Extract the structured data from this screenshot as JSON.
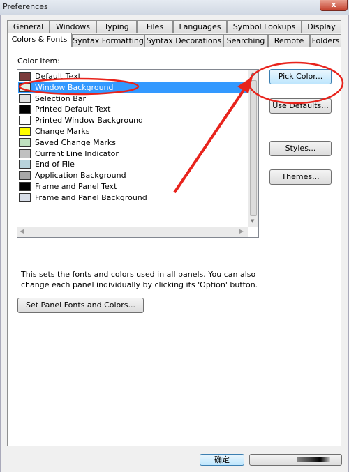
{
  "window": {
    "title": "Preferences",
    "close_label": "x"
  },
  "tabs_row1": [
    "General",
    "Windows",
    "Typing",
    "Files",
    "Languages",
    "Symbol Lookups",
    "Display"
  ],
  "tabs_row2": [
    "Colors & Fonts",
    "Syntax Formatting",
    "Syntax Decorations",
    "Searching",
    "Remote",
    "Folders"
  ],
  "active_tab": "Colors & Fonts",
  "color_item_label": "Color Item:",
  "color_items": [
    {
      "label": "Default Text",
      "color": "#7b3a3a"
    },
    {
      "label": "Window Background",
      "color": "#dfeee0",
      "selected": true
    },
    {
      "label": "Selection Bar",
      "color": "#e0e0e0"
    },
    {
      "label": "Printed Default Text",
      "color": "#000000"
    },
    {
      "label": "Printed Window Background",
      "color": "#ffffff"
    },
    {
      "label": "Change Marks",
      "color": "#ffff00"
    },
    {
      "label": "Saved Change Marks",
      "color": "#bfe0bf"
    },
    {
      "label": "Current Line Indicator",
      "color": "#c0c0c0"
    },
    {
      "label": "End of File",
      "color": "#b8d4dc"
    },
    {
      "label": "Application Background",
      "color": "#a8a8a8"
    },
    {
      "label": "Frame and Panel Text",
      "color": "#000000"
    },
    {
      "label": "Frame and Panel Background",
      "color": "#d8dee8"
    }
  ],
  "buttons": {
    "pick_color": "Pick Color...",
    "use_defaults": "Use Defaults...",
    "styles": "Styles...",
    "themes": "Themes...",
    "set_panel": "Set Panel Fonts and Colors...",
    "ok": "确定",
    "cancel": ""
  },
  "description": "This sets the fonts and colors used in all panels. You can also change each panel individually by clicking its 'Option' button.",
  "annotation_color": "#e8231c"
}
